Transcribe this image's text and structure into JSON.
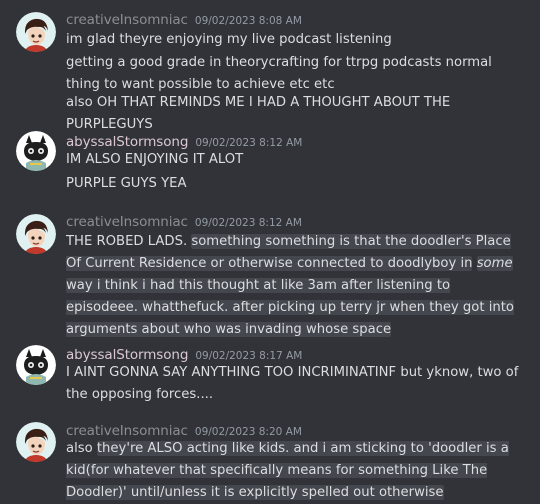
{
  "colors": {
    "background": "#313338",
    "text": "#dbdee1",
    "timestamp": "#949ba4",
    "creativeInsomniac_name": "#8a8e93",
    "abyssalStormsong_name": "#dbc8d3",
    "highlight": "#4b4d53"
  },
  "messages": [
    {
      "author": "creativeInsomniac",
      "timestamp": "09/02/2023 8:08 AM",
      "avatar_icon": "cartoon-boy-avatar-icon",
      "lines": [
        "im glad theyre enjoying my live podcast listening",
        "getting a good grade in theorycrafting for ttrpg podcasts normal thing to want possible to achieve etc etc",
        "also OH THAT REMINDS ME I HAD A THOUGHT ABOUT THE PURPLEGUYS"
      ]
    },
    {
      "author": "abyssalStormsong",
      "timestamp": "09/02/2023 8:12 AM",
      "avatar_icon": "cartoon-creature-avatar-icon",
      "lines": [
        "IM ALSO ENJOYING IT ALOT",
        "PURPLE GUYS YEA"
      ]
    },
    {
      "author": "creativeInsomniac",
      "timestamp": "09/02/2023 8:12 AM",
      "avatar_icon": "cartoon-boy-avatar-icon",
      "segments": {
        "s1": "THE ROBED LADS.",
        "s2": "something something is that the doodler's Place Of Current Residence or otherwise connected to doodlyboy in",
        "s3": "some",
        "s4": "way i think i had this thought at like 3am after listening to episodeee. whatthefuck. after picking up terry jr when they got into arguments about who was invading whose space"
      }
    },
    {
      "author": "abyssalStormsong",
      "timestamp": "09/02/2023 8:17 AM",
      "avatar_icon": "cartoon-creature-avatar-icon",
      "lines": [
        "I AINT GONNA SAY ANYTHING TOO INCRIMINATINF but yknow, two of the opposing forces...."
      ]
    },
    {
      "author": "creativeInsomniac",
      "timestamp": "09/02/2023 8:20 AM",
      "avatar_icon": "cartoon-boy-avatar-icon",
      "segments": {
        "s1": "also",
        "s2": "they're ALSO acting like kids. and i am sticking to 'doodler is a kid(for whatever that specifically means for something Like The Doodler)' until/unless it is explicitly spelled out otherwise"
      }
    }
  ]
}
